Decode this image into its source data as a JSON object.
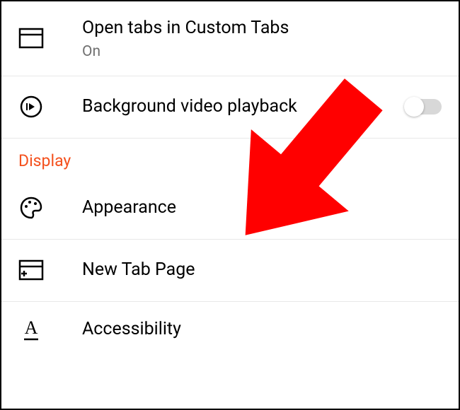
{
  "settings": {
    "items": [
      {
        "icon": "tab-icon",
        "label": "Open tabs in Custom Tabs",
        "subtitle": "On",
        "has_toggle": false
      },
      {
        "icon": "play-circle-icon",
        "label": "Background video playback",
        "subtitle": null,
        "has_toggle": true,
        "toggle_on": false
      }
    ],
    "section_header": "Display",
    "display_items": [
      {
        "icon": "palette-icon",
        "label": "Appearance"
      },
      {
        "icon": "new-tab-icon",
        "label": "New Tab Page"
      },
      {
        "icon": "accessibility-icon",
        "label": "Accessibility"
      }
    ]
  }
}
